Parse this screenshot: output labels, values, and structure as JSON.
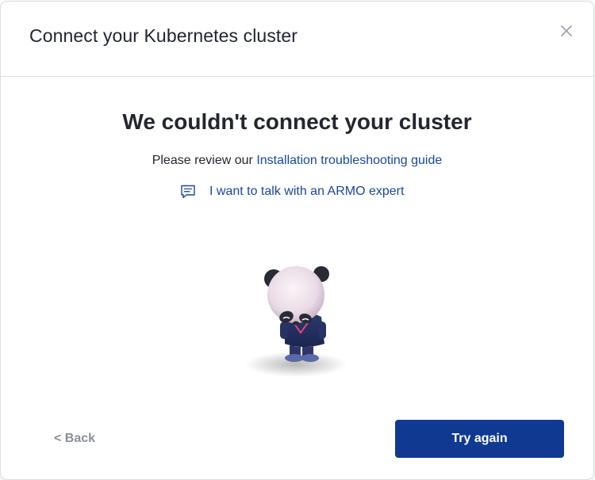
{
  "dialog": {
    "title": "Connect your Kubernetes cluster",
    "close_icon": "close-icon"
  },
  "content": {
    "heading": "We couldn't connect your cluster",
    "review_prefix": "Please review our",
    "troubleshooting_link": "Installation troubleshooting guide",
    "expert_link": "I want to talk with an ARMO expert",
    "expert_icon": "chat-icon",
    "illustration": "sad-panda-mascot"
  },
  "footer": {
    "back_label": "< Back",
    "primary_label": "Try again"
  },
  "colors": {
    "primary": "#103a91",
    "link": "#1a47a0",
    "text": "#22262e",
    "muted": "#8a8f98",
    "divider": "#d6e2ee"
  }
}
